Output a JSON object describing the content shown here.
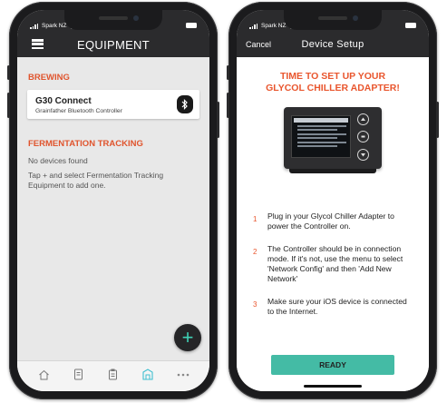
{
  "left_phone": {
    "status": {
      "carrier": "Spark NZ",
      "time": "3:17 PM"
    },
    "nav": {
      "title": "EQUIPMENT",
      "menu_icon": "hamburger-menu-icon"
    },
    "brewing": {
      "title": "BREWING",
      "device": {
        "name": "G30 Connect",
        "subtitle": "Grainfather Bluetooth Controller",
        "icon": "bluetooth-icon"
      }
    },
    "fermentation": {
      "title": "FERMENTATION TRACKING",
      "empty": "No devices found",
      "hint": "Tap + and select Fermentation Tracking Equipment to add one."
    },
    "fab_label": "+",
    "tabs": [
      "home-icon",
      "recipe-icon",
      "list-icon",
      "equipment-icon",
      "more-icon"
    ],
    "colors": {
      "accent": "#e0542d",
      "teal": "#3fd0b5",
      "header": "#2b2b2d"
    }
  },
  "right_phone": {
    "status": {
      "carrier": "Spark NZ",
      "time": "3:17 PM"
    },
    "nav": {
      "cancel": "Cancel",
      "title": "Device Setup"
    },
    "headline": "TIME TO SET UP YOUR GLYCOL CHILLER ADAPTER!",
    "steps": [
      {
        "num": "1",
        "text": "Plug in your Glycol Chiller Adapter to power the Controller on."
      },
      {
        "num": "2",
        "text": "The Controller should be in connection mode. If it's not, use the menu to select 'Network Config' and then 'Add New Network'"
      },
      {
        "num": "3",
        "text": "Make sure your iOS device is connected to the Internet."
      }
    ],
    "ready_label": "READY",
    "colors": {
      "accent": "#e9562e",
      "button": "#44bba5"
    }
  }
}
